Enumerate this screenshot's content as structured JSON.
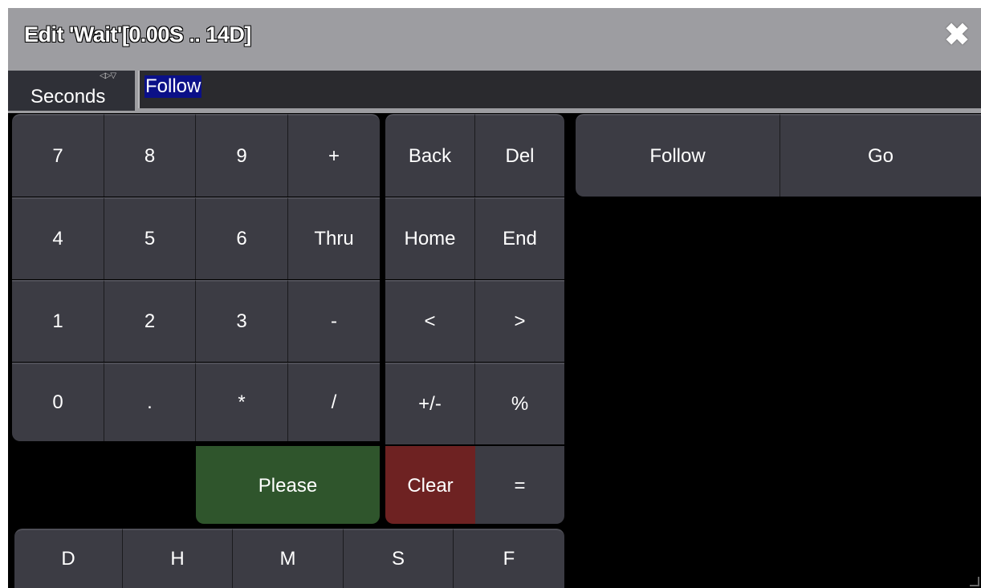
{
  "window": {
    "title": "Edit 'Wait'[0.00S .. 14D]",
    "close_icon": "close-icon"
  },
  "input": {
    "unit": "Seconds",
    "value": "Follow"
  },
  "keypad": {
    "numeric": [
      [
        "7",
        "8",
        "9",
        "+"
      ],
      [
        "4",
        "5",
        "6",
        "Thru"
      ],
      [
        "1",
        "2",
        "3",
        "-"
      ],
      [
        "0",
        ".",
        "*",
        "/"
      ]
    ],
    "edit": [
      [
        "Back",
        "Del"
      ],
      [
        "Home",
        "End"
      ],
      [
        "<",
        ">"
      ],
      [
        "+/-",
        "%"
      ]
    ],
    "please": "Please",
    "clear": "Clear",
    "equals": "=",
    "units": [
      "D",
      "H",
      "M",
      "S",
      "F"
    ]
  },
  "presets": [
    "Follow",
    "Go"
  ],
  "colors": {
    "key": "#3c3c44",
    "please": "#2f552c",
    "clear": "#6e2222",
    "titlebar": "#9d9da1",
    "selection": "#0b1088"
  }
}
